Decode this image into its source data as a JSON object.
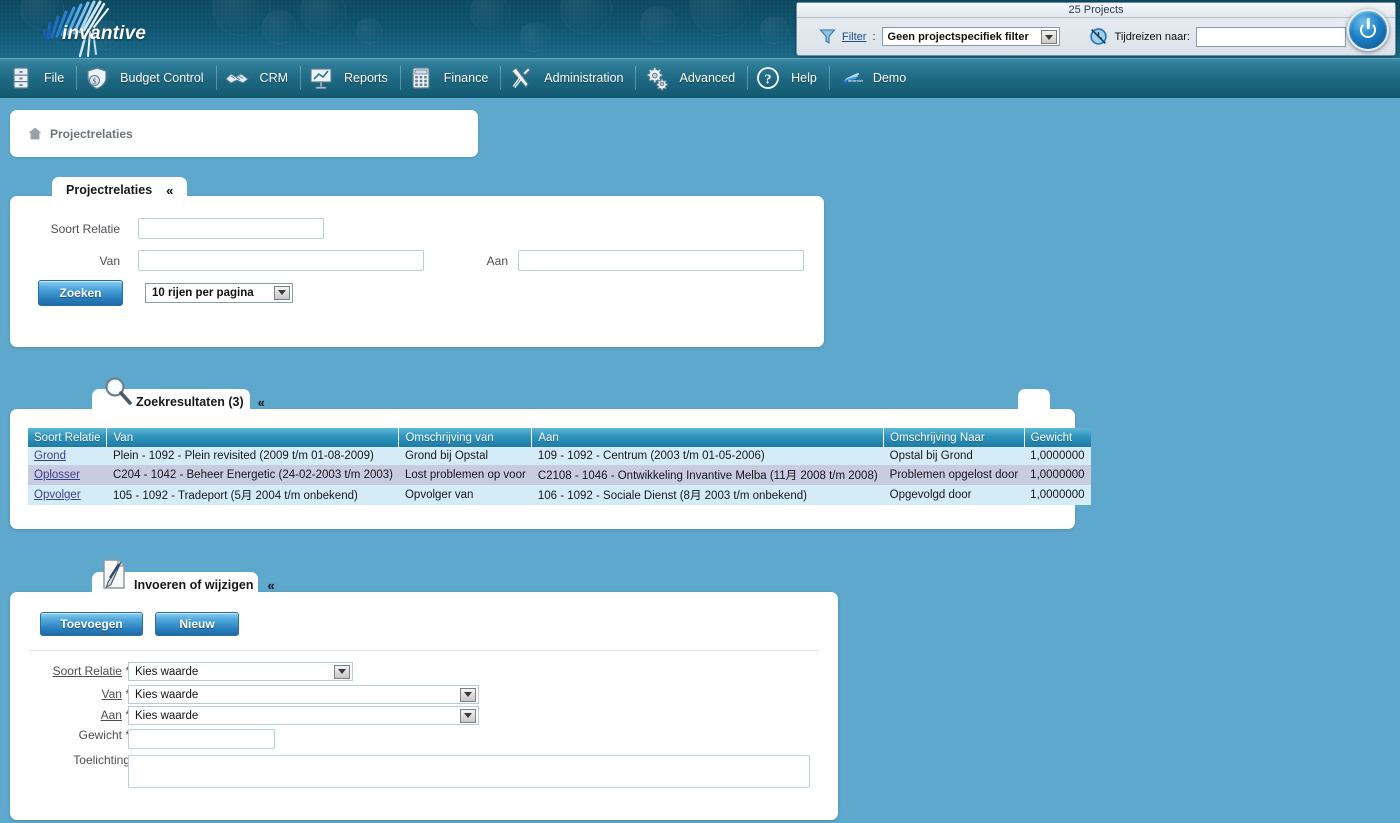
{
  "banner": {
    "logo_text": "invantive",
    "logo_icon": "invantive-burst-logo"
  },
  "console": {
    "title": "25 Projects",
    "filter_label": "Filter",
    "filter_colon": ":",
    "filter_value": "Geen projectspecifiek filter",
    "filter_icon": "funnel-icon",
    "time_icon": "clock-icon",
    "time_label": "Tijdreizen naar:",
    "time_value": "",
    "power_icon": "power-icon"
  },
  "menu": {
    "items": [
      {
        "label": "File",
        "icon": "cabinet-icon"
      },
      {
        "label": "Budget Control",
        "icon": "money-shield-icon"
      },
      {
        "label": "CRM",
        "icon": "handshake-icon"
      },
      {
        "label": "Reports",
        "icon": "presentation-chart-icon"
      },
      {
        "label": "Finance",
        "icon": "calculator-icon"
      },
      {
        "label": "Administration",
        "icon": "tools-icon"
      },
      {
        "label": "Advanced",
        "icon": "gears-icon"
      },
      {
        "label": "Help",
        "icon": "question-circle-icon"
      },
      {
        "label": "Demo",
        "icon": "invantive-small-icon"
      }
    ]
  },
  "breadcrumb": {
    "home_icon": "home-icon",
    "label": "Projectrelaties"
  },
  "search_panel": {
    "tab_title": "Projectrelaties",
    "collapse_icon": "chevron-up-icon",
    "fields": {
      "soort_relatie_label": "Soort Relatie",
      "soort_relatie_value": "",
      "van_label": "Van",
      "van_value": "",
      "aan_label": "Aan",
      "aan_value": ""
    },
    "search_button": "Zoeken",
    "rows_per_page": "10 rijen per pagina"
  },
  "results_panel": {
    "tab_title": "Zoekresultaten (3)",
    "tab_icon": "magnifier-icon",
    "collapse_icon": "chevron-up-icon",
    "columns": [
      "Soort Relatie",
      "Van",
      "Omschrijving van",
      "Aan",
      "Omschrijving Naar",
      "Gewicht"
    ],
    "rows": [
      {
        "soort_relatie": "Grond",
        "van": "Plein - 1092 - Plein revisited (2009 t/m 01-08-2009)",
        "omschrijving_van": "Grond bij Opstal",
        "aan": "109 - 1092 - Centrum (2003 t/m 01-05-2006)",
        "omschrijving_naar": "Opstal bij Grond",
        "gewicht": "1,0000000"
      },
      {
        "soort_relatie": "Oplosser",
        "van": "C204 - 1042 - Beheer Energetic (24-02-2003 t/m 2003)",
        "omschrijving_van": "Lost problemen op voor",
        "aan": "C2108 - 1046 - Ontwikkeling Invantive Melba (11月 2008 t/m 2008)",
        "omschrijving_naar": "Problemen opgelost door",
        "gewicht": "1,0000000"
      },
      {
        "soort_relatie": "Opvolger",
        "van": "105 - 1092 - Tradeport (5月 2004 t/m onbekend)",
        "omschrijving_van": "Opvolger van",
        "aan": "106 - 1092 - Sociale Dienst (8月 2003 t/m onbekend)",
        "omschrijving_naar": "Opgevolgd door",
        "gewicht": "1,0000000"
      }
    ]
  },
  "edit_panel": {
    "tab_title": "Invoeren of wijzigen",
    "tab_icon": "document-pencil-icon",
    "collapse_icon": "chevron-up-icon",
    "add_button": "Toevoegen",
    "new_button": "Nieuw",
    "fields": [
      {
        "label": "Soort Relatie",
        "required": "*",
        "value": "Kies waarde",
        "type": "select"
      },
      {
        "label": "Van",
        "required": "*",
        "value": "Kies waarde",
        "type": "select"
      },
      {
        "label": "Aan",
        "required": "*",
        "value": "Kies waarde",
        "type": "select"
      },
      {
        "label": "Gewicht",
        "required": "*",
        "value": "",
        "type": "text"
      },
      {
        "label": "Toelichting",
        "required": "",
        "value": "",
        "type": "textarea"
      }
    ]
  },
  "colors": {
    "page_background": "#5ea8cd",
    "banner_dark": "#10536e",
    "menu_blue": "#1d6882",
    "header_blue": "#2e94bd",
    "row_even": "#d4ecf7",
    "row_odd": "#c9cbe0",
    "link": "#3b3f8c"
  }
}
